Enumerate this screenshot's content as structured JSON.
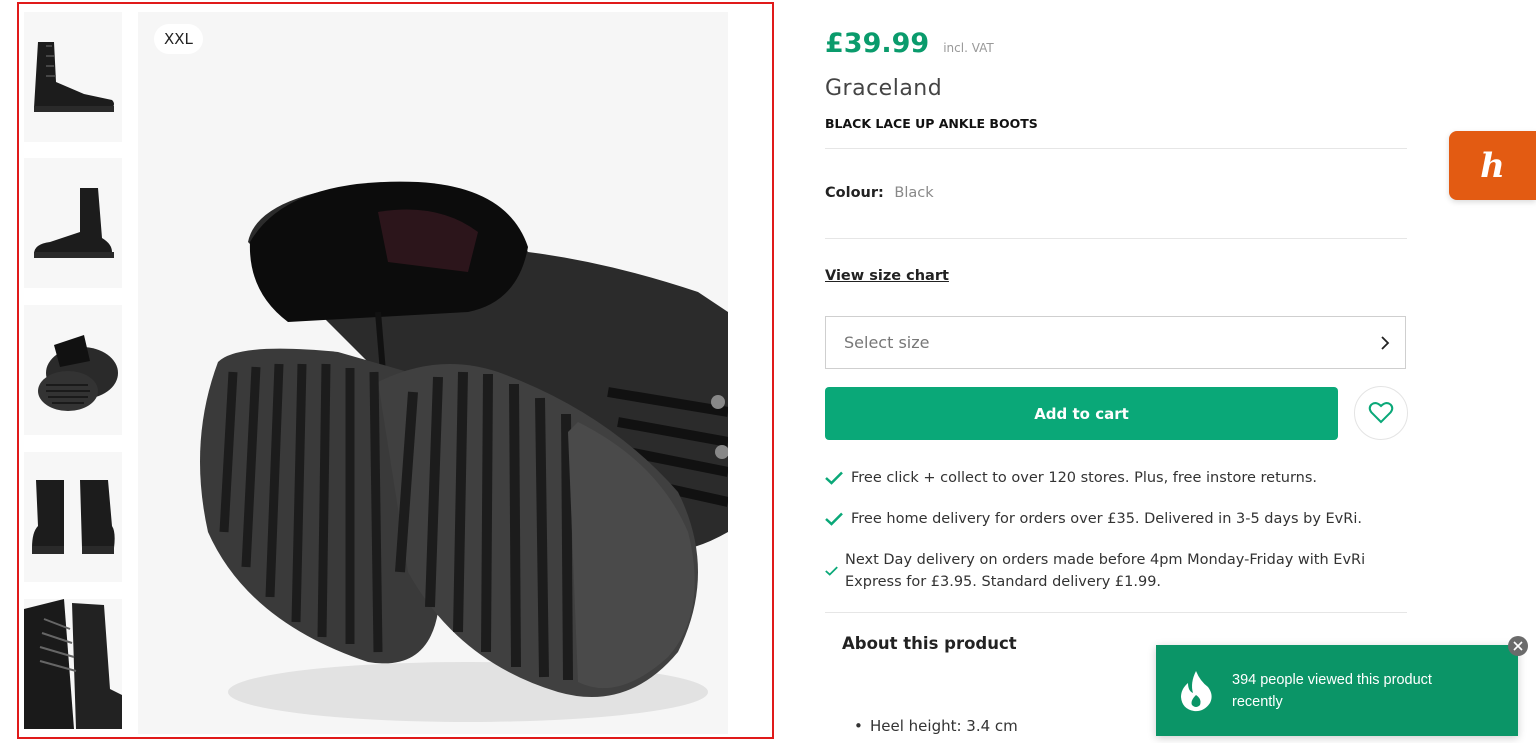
{
  "gallery": {
    "size_tag": "XXL",
    "thumbnails": [
      {
        "alt": "side-view-boot"
      },
      {
        "alt": "side-view-boot-alt"
      },
      {
        "alt": "sole-view-boots",
        "active": true
      },
      {
        "alt": "rear-view-boots"
      },
      {
        "alt": "laces-closeup-boots"
      }
    ]
  },
  "product": {
    "price": "£39.99",
    "vat_note": "incl. VAT",
    "brand": "Graceland",
    "name": "BLACK LACE UP ANKLE BOOTS",
    "colour_label": "Colour:",
    "colour_value": "Black",
    "size_chart_link": "View size chart",
    "size_select_placeholder": "Select size",
    "add_to_cart_label": "Add to cart",
    "perks": [
      "Free click + collect to over 120 stores. Plus, free instore returns.",
      "Free home delivery for orders over £35. Delivered in 3-5 days by EvRi.",
      "Next Day delivery on orders made before 4pm Monday-Friday with EvRi Express for £3.95. Standard delivery £1.99."
    ],
    "about_title": "About this product",
    "details": [
      "Heel height: 3.4 cm"
    ]
  },
  "toast": {
    "message": "394 people viewed this product recently"
  },
  "colors": {
    "accent_green": "#0aa878",
    "price_green": "#0a9b6c",
    "honey_orange": "#e35b12",
    "highlight_border": "#e01a1a"
  }
}
